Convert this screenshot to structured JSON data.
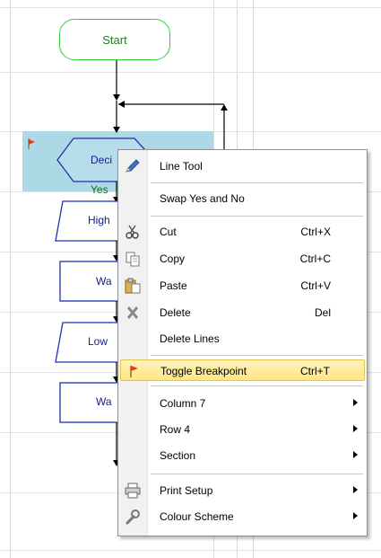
{
  "flowchart": {
    "start_label": "Start",
    "decision_text": "Deci",
    "yes_label": "Yes",
    "box1_text": "High",
    "box2_text": "Wa",
    "box3_text": "Low",
    "box4_text": "Wa"
  },
  "context_menu": {
    "line_tool": "Line Tool",
    "swap": "Swap Yes and No",
    "cut": "Cut",
    "cut_shortcut": "Ctrl+X",
    "copy": "Copy",
    "copy_shortcut": "Ctrl+C",
    "paste": "Paste",
    "paste_shortcut": "Ctrl+V",
    "delete": "Delete",
    "delete_shortcut": "Del",
    "delete_lines": "Delete Lines",
    "toggle_breakpoint": "Toggle Breakpoint",
    "toggle_breakpoint_shortcut": "Ctrl+T",
    "column": "Column 7",
    "row": "Row 4",
    "section": "Section",
    "print_setup": "Print Setup",
    "colour_scheme": "Colour Scheme"
  },
  "colors": {
    "selection": "#add8e6",
    "flow_border": "#1f2fb3",
    "start_border": "#33cc33",
    "menu_highlight": "#ffe680"
  }
}
